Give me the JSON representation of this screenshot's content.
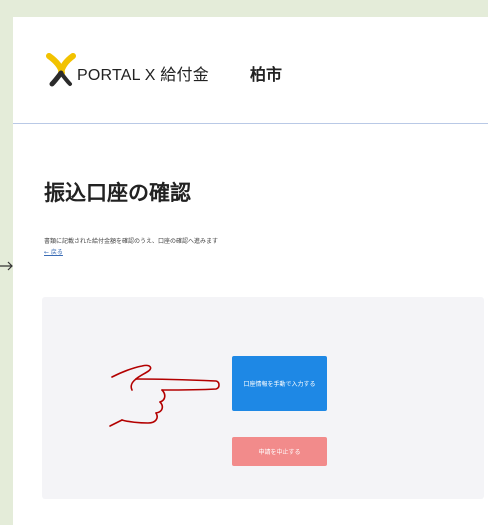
{
  "header": {
    "brand_name": "PORTAL X 給付金",
    "municipality": "柏市"
  },
  "main": {
    "title": "振込口座の確認",
    "description": "書類に記載された給付金額を確認のうえ、口座の確認へ進みます",
    "back_link": "← 戻る"
  },
  "actions": {
    "manual_entry_label": "口座情報を手動で入力する",
    "cancel_label": "申請を中止する"
  },
  "colors": {
    "background": "#e4ecd9",
    "primary_button": "#1e88e5",
    "cancel_button": "#f28b8b",
    "logo_yellow": "#f2c200",
    "logo_dark": "#2b2b2b",
    "hand_annotation": "#b30000"
  }
}
